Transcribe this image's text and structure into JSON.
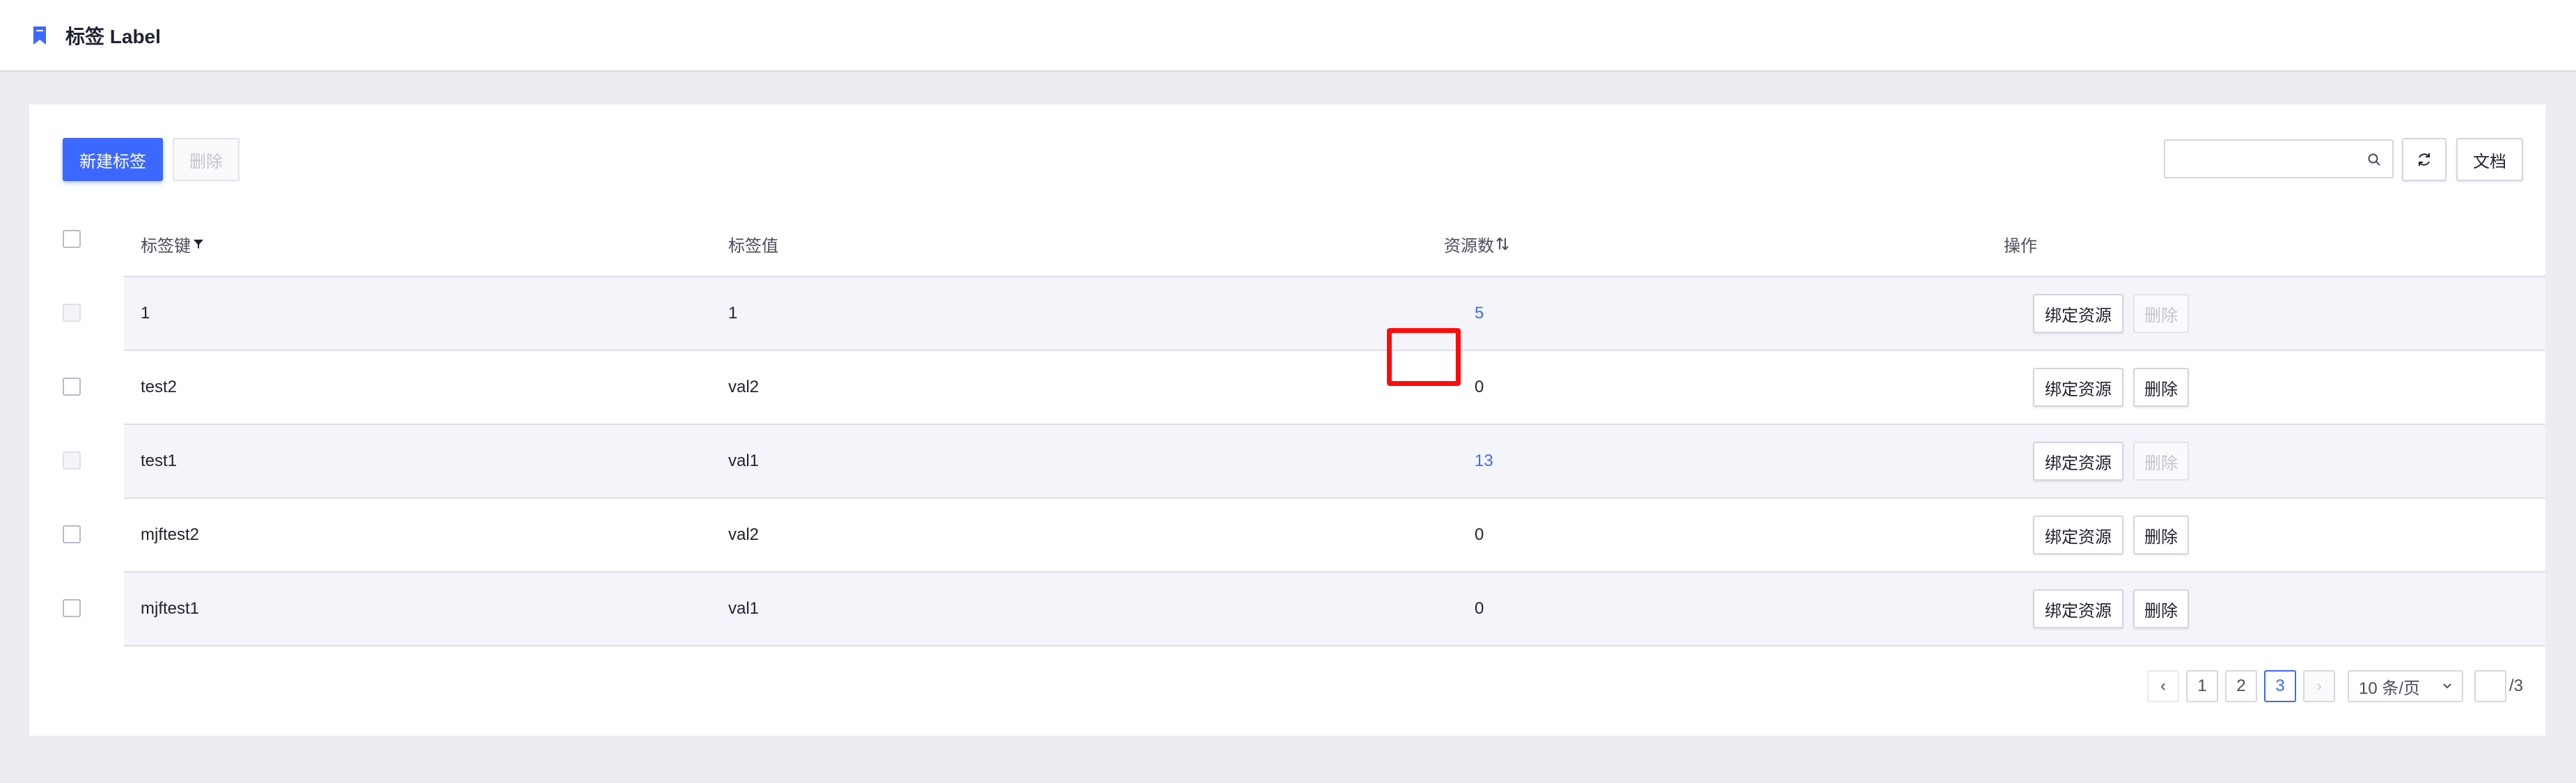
{
  "header": {
    "title": "标签 Label",
    "icon": "bookmark-icon",
    "accent": "#3d68ff"
  },
  "toolbar": {
    "create_label": "新建标签",
    "delete_label": "删除",
    "search_placeholder": "",
    "refresh_icon": "refresh-icon",
    "docs_label": "文档"
  },
  "table": {
    "columns": {
      "key": "标签键",
      "value": "标签值",
      "count": "资源数",
      "actions": "操作"
    },
    "rows": [
      {
        "key": "1",
        "value": "1",
        "count": "5",
        "count_link": true,
        "bind": "绑定资源",
        "delete": "删除",
        "delete_disabled": true,
        "checkbox_disabled": true
      },
      {
        "key": "test2",
        "value": "val2",
        "count": "0",
        "count_link": false,
        "bind": "绑定资源",
        "delete": "删除",
        "delete_disabled": false,
        "checkbox_disabled": false
      },
      {
        "key": "test1",
        "value": "val1",
        "count": "13",
        "count_link": true,
        "bind": "绑定资源",
        "delete": "删除",
        "delete_disabled": true,
        "checkbox_disabled": true
      },
      {
        "key": "mjftest2",
        "value": "val2",
        "count": "0",
        "count_link": false,
        "bind": "绑定资源",
        "delete": "删除",
        "delete_disabled": false,
        "checkbox_disabled": false
      },
      {
        "key": "mjftest1",
        "value": "val1",
        "count": "0",
        "count_link": false,
        "bind": "绑定资源",
        "delete": "删除",
        "delete_disabled": false,
        "checkbox_disabled": false
      }
    ]
  },
  "pagination": {
    "prev": "‹",
    "pages": [
      "1",
      "2",
      "3"
    ],
    "current": "3",
    "next": "›",
    "page_size": "10 条/页",
    "jump_value": "",
    "total": "/3"
  }
}
